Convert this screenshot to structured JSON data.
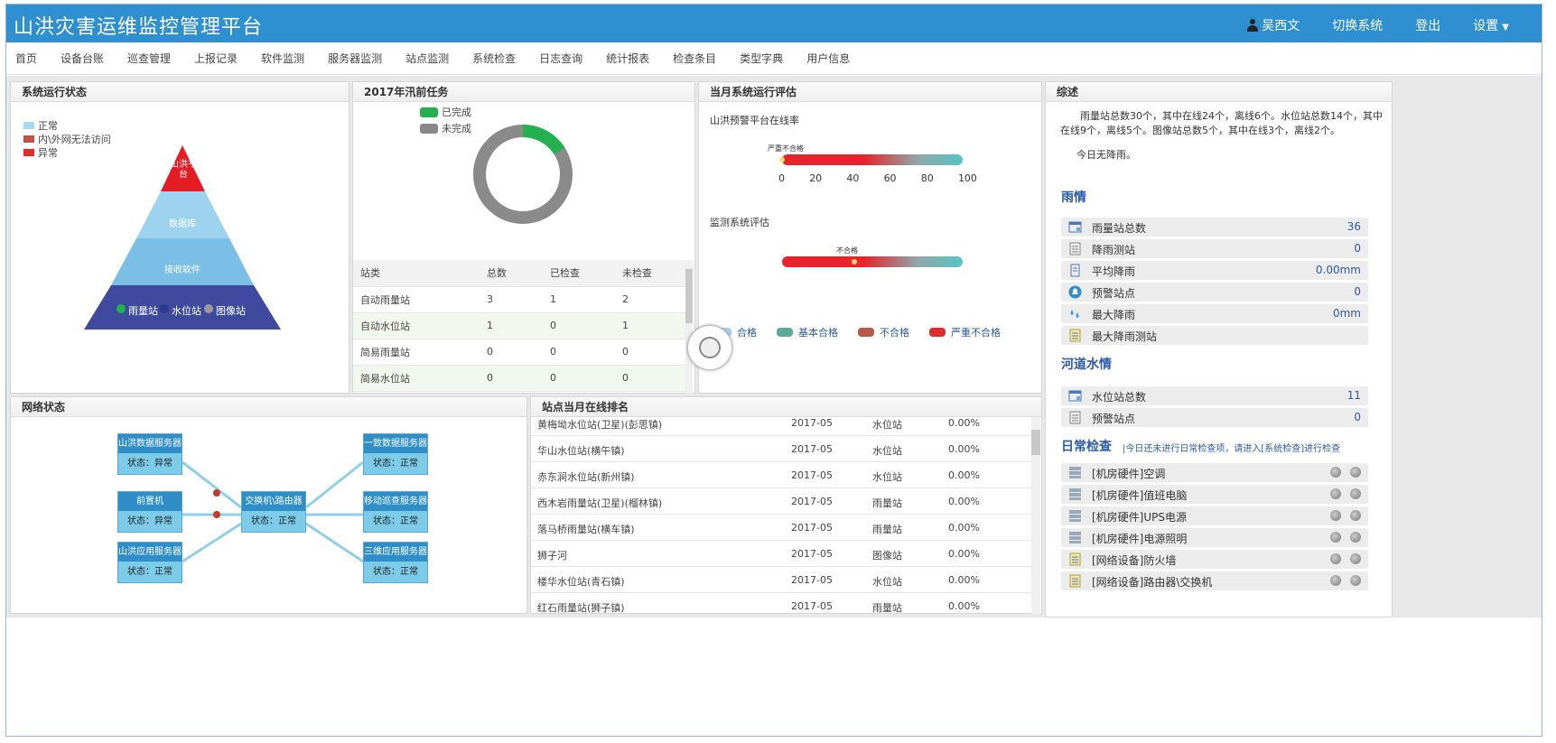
{
  "header": {
    "title": "山洪灾害运维监控管理平台",
    "user": "吴西文",
    "switch_system": "切换系统",
    "logout": "登出",
    "settings": "设置"
  },
  "nav": [
    "首页",
    "设备台账",
    "巡查管理",
    "上报记录",
    "软件监测",
    "服务器监测",
    "站点监测",
    "系统检查",
    "日志查询",
    "统计报表",
    "检查条目",
    "类型字典",
    "用户信息"
  ],
  "system_status": {
    "title": "系统运行状态",
    "legend": [
      {
        "label": "正常",
        "color": "#a6d8f0"
      },
      {
        "label": "内\\外网无法访问",
        "color": "#b9574a"
      },
      {
        "label": "异常",
        "color": "#e22b2b"
      }
    ],
    "pyramid": {
      "top": "山洪平台",
      "db": "数据库",
      "recv": "接收软件",
      "stations": [
        "雨量站",
        "水位站",
        "图像站"
      ],
      "colors": [
        "#e31d23",
        "#9ed3f0",
        "#7bbfe7",
        "#3f4a9e"
      ]
    }
  },
  "tasks": {
    "title": "2017年汛前任务",
    "legend_done": "已完成",
    "legend_undone": "未完成",
    "done_fraction": 0.16,
    "columns": [
      "站类",
      "总数",
      "已检查",
      "未检查"
    ],
    "rows": [
      [
        "自动雨量站",
        "3",
        "1",
        "2"
      ],
      [
        "自动水位站",
        "1",
        "0",
        "1"
      ],
      [
        "简易雨量站",
        "0",
        "0",
        "0"
      ],
      [
        "简易水位站",
        "0",
        "0",
        "0"
      ]
    ]
  },
  "eval": {
    "title": "当月系统运行评估",
    "online_label": "山洪预警平台在线率",
    "gauge1_tag": "严重不合格",
    "ticks": [
      "0",
      "20",
      "40",
      "60",
      "80",
      "100"
    ],
    "gauge1_value": 0,
    "monitor_label": "监测系统评估",
    "gauge2_tag": "不合格",
    "gauge2_value": 40,
    "legend": [
      {
        "label": "合格",
        "color": "#9ed3f0"
      },
      {
        "label": "基本合格",
        "color": "#5aa99a"
      },
      {
        "label": "不合格",
        "color": "#b9574a"
      },
      {
        "label": "严重不合格",
        "color": "#e22b2b"
      }
    ]
  },
  "summary": {
    "title": "综述",
    "text": "雨量站总数30个，其中在线24个，离线6个。水位站总数14个，其中在线9个，离线5个。图像站总数5个，其中在线3个，离线2个。",
    "no_rain": "今日无降雨。",
    "rain_title": "雨情",
    "rain_items": [
      {
        "label": "雨量站总数",
        "value": "36",
        "icon": "rain-station-icon"
      },
      {
        "label": "降雨测站",
        "value": "0",
        "icon": "list-icon"
      },
      {
        "label": "平均降雨",
        "value": "0.00mm",
        "icon": "doc-icon"
      },
      {
        "label": "预警站点",
        "value": "0",
        "icon": "alarm-icon"
      },
      {
        "label": "最大降雨",
        "value": "0mm",
        "icon": "drops-icon"
      },
      {
        "label": "最大降雨测站",
        "value": "",
        "icon": "doc-list-icon"
      }
    ],
    "river_title": "河道水情",
    "river_items": [
      {
        "label": "水位站总数",
        "value": "11",
        "icon": "water-station-icon"
      },
      {
        "label": "预警站点",
        "value": "0",
        "icon": "list-icon"
      }
    ],
    "daily_title": "日常检查",
    "daily_note": "|今日还未进行日常检查项，请进入[系统检查]进行检查",
    "daily_items": [
      "[机房硬件]空调",
      "[机房硬件]值班电脑",
      "[机房硬件]UPS电源",
      "[机房硬件]电源照明",
      "[网络设备]防火墙",
      "[网络设备]路由器\\交换机"
    ]
  },
  "network": {
    "title": "网络状态",
    "left_boxes": [
      {
        "name": "山洪数据服务器",
        "status": "状态：异常"
      },
      {
        "name": "前置机",
        "status": "状态：异常"
      },
      {
        "name": "山洪应用服务器",
        "status": "状态：正常"
      }
    ],
    "center_box": {
      "name": "交换机\\路由器",
      "status": "状态：正常"
    },
    "right_boxes": [
      {
        "name": "一致数据服务器",
        "status": "状态：正常"
      },
      {
        "name": "移动巡查服务器",
        "status": "状态：正常"
      },
      {
        "name": "三维应用服务器",
        "status": "状态：正常"
      }
    ]
  },
  "ranking": {
    "title": "站点当月在线排名",
    "rows": [
      [
        "黄梅坳水位站(卫星)(彭思镇)",
        "2017-05",
        "水位站",
        "0.00%"
      ],
      [
        "华山水位站(横午镇)",
        "2017-05",
        "水位站",
        "0.00%"
      ],
      [
        "赤东涧水位站(新州镇)",
        "2017-05",
        "水位站",
        "0.00%"
      ],
      [
        "西木岩雨量站(卫星)(榴林镇)",
        "2017-05",
        "雨量站",
        "0.00%"
      ],
      [
        "落马桥雨量站(横车镇)",
        "2017-05",
        "雨量站",
        "0.00%"
      ],
      [
        "狮子河",
        "2017-05",
        "图像站",
        "0.00%"
      ],
      [
        "楼华水位站(青石镇)",
        "2017-05",
        "水位站",
        "0.00%"
      ],
      [
        "红石雨量站(狮子镇)",
        "2017-05",
        "雨量站",
        "0.00%"
      ]
    ]
  }
}
